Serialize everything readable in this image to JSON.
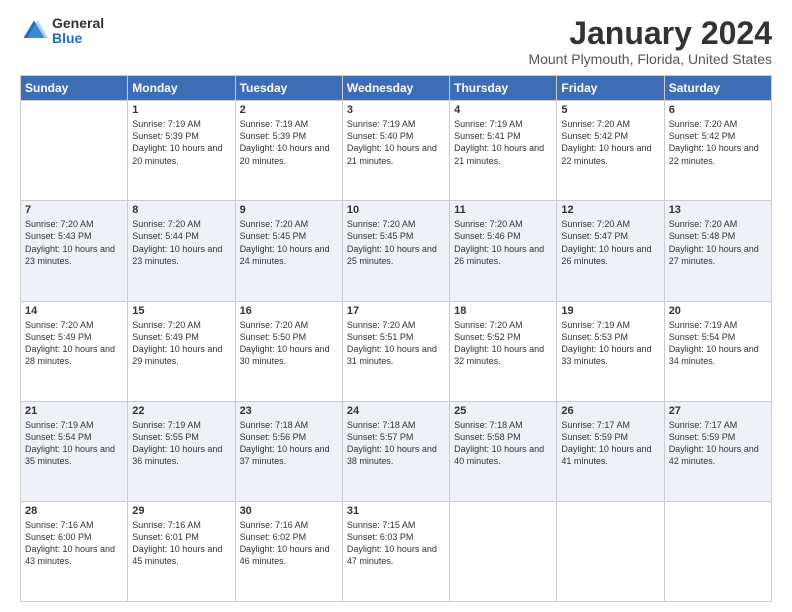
{
  "logo": {
    "general": "General",
    "blue": "Blue"
  },
  "header": {
    "title": "January 2024",
    "subtitle": "Mount Plymouth, Florida, United States"
  },
  "weekdays": [
    "Sunday",
    "Monday",
    "Tuesday",
    "Wednesday",
    "Thursday",
    "Friday",
    "Saturday"
  ],
  "weeks": [
    [
      {
        "day": "",
        "sunrise": "",
        "sunset": "",
        "daylight": ""
      },
      {
        "day": "1",
        "sunrise": "Sunrise: 7:19 AM",
        "sunset": "Sunset: 5:39 PM",
        "daylight": "Daylight: 10 hours and 20 minutes."
      },
      {
        "day": "2",
        "sunrise": "Sunrise: 7:19 AM",
        "sunset": "Sunset: 5:39 PM",
        "daylight": "Daylight: 10 hours and 20 minutes."
      },
      {
        "day": "3",
        "sunrise": "Sunrise: 7:19 AM",
        "sunset": "Sunset: 5:40 PM",
        "daylight": "Daylight: 10 hours and 21 minutes."
      },
      {
        "day": "4",
        "sunrise": "Sunrise: 7:19 AM",
        "sunset": "Sunset: 5:41 PM",
        "daylight": "Daylight: 10 hours and 21 minutes."
      },
      {
        "day": "5",
        "sunrise": "Sunrise: 7:20 AM",
        "sunset": "Sunset: 5:42 PM",
        "daylight": "Daylight: 10 hours and 22 minutes."
      },
      {
        "day": "6",
        "sunrise": "Sunrise: 7:20 AM",
        "sunset": "Sunset: 5:42 PM",
        "daylight": "Daylight: 10 hours and 22 minutes."
      }
    ],
    [
      {
        "day": "7",
        "sunrise": "Sunrise: 7:20 AM",
        "sunset": "Sunset: 5:43 PM",
        "daylight": "Daylight: 10 hours and 23 minutes."
      },
      {
        "day": "8",
        "sunrise": "Sunrise: 7:20 AM",
        "sunset": "Sunset: 5:44 PM",
        "daylight": "Daylight: 10 hours and 23 minutes."
      },
      {
        "day": "9",
        "sunrise": "Sunrise: 7:20 AM",
        "sunset": "Sunset: 5:45 PM",
        "daylight": "Daylight: 10 hours and 24 minutes."
      },
      {
        "day": "10",
        "sunrise": "Sunrise: 7:20 AM",
        "sunset": "Sunset: 5:45 PM",
        "daylight": "Daylight: 10 hours and 25 minutes."
      },
      {
        "day": "11",
        "sunrise": "Sunrise: 7:20 AM",
        "sunset": "Sunset: 5:46 PM",
        "daylight": "Daylight: 10 hours and 26 minutes."
      },
      {
        "day": "12",
        "sunrise": "Sunrise: 7:20 AM",
        "sunset": "Sunset: 5:47 PM",
        "daylight": "Daylight: 10 hours and 26 minutes."
      },
      {
        "day": "13",
        "sunrise": "Sunrise: 7:20 AM",
        "sunset": "Sunset: 5:48 PM",
        "daylight": "Daylight: 10 hours and 27 minutes."
      }
    ],
    [
      {
        "day": "14",
        "sunrise": "Sunrise: 7:20 AM",
        "sunset": "Sunset: 5:49 PM",
        "daylight": "Daylight: 10 hours and 28 minutes."
      },
      {
        "day": "15",
        "sunrise": "Sunrise: 7:20 AM",
        "sunset": "Sunset: 5:49 PM",
        "daylight": "Daylight: 10 hours and 29 minutes."
      },
      {
        "day": "16",
        "sunrise": "Sunrise: 7:20 AM",
        "sunset": "Sunset: 5:50 PM",
        "daylight": "Daylight: 10 hours and 30 minutes."
      },
      {
        "day": "17",
        "sunrise": "Sunrise: 7:20 AM",
        "sunset": "Sunset: 5:51 PM",
        "daylight": "Daylight: 10 hours and 31 minutes."
      },
      {
        "day": "18",
        "sunrise": "Sunrise: 7:20 AM",
        "sunset": "Sunset: 5:52 PM",
        "daylight": "Daylight: 10 hours and 32 minutes."
      },
      {
        "day": "19",
        "sunrise": "Sunrise: 7:19 AM",
        "sunset": "Sunset: 5:53 PM",
        "daylight": "Daylight: 10 hours and 33 minutes."
      },
      {
        "day": "20",
        "sunrise": "Sunrise: 7:19 AM",
        "sunset": "Sunset: 5:54 PM",
        "daylight": "Daylight: 10 hours and 34 minutes."
      }
    ],
    [
      {
        "day": "21",
        "sunrise": "Sunrise: 7:19 AM",
        "sunset": "Sunset: 5:54 PM",
        "daylight": "Daylight: 10 hours and 35 minutes."
      },
      {
        "day": "22",
        "sunrise": "Sunrise: 7:19 AM",
        "sunset": "Sunset: 5:55 PM",
        "daylight": "Daylight: 10 hours and 36 minutes."
      },
      {
        "day": "23",
        "sunrise": "Sunrise: 7:18 AM",
        "sunset": "Sunset: 5:56 PM",
        "daylight": "Daylight: 10 hours and 37 minutes."
      },
      {
        "day": "24",
        "sunrise": "Sunrise: 7:18 AM",
        "sunset": "Sunset: 5:57 PM",
        "daylight": "Daylight: 10 hours and 38 minutes."
      },
      {
        "day": "25",
        "sunrise": "Sunrise: 7:18 AM",
        "sunset": "Sunset: 5:58 PM",
        "daylight": "Daylight: 10 hours and 40 minutes."
      },
      {
        "day": "26",
        "sunrise": "Sunrise: 7:17 AM",
        "sunset": "Sunset: 5:59 PM",
        "daylight": "Daylight: 10 hours and 41 minutes."
      },
      {
        "day": "27",
        "sunrise": "Sunrise: 7:17 AM",
        "sunset": "Sunset: 5:59 PM",
        "daylight": "Daylight: 10 hours and 42 minutes."
      }
    ],
    [
      {
        "day": "28",
        "sunrise": "Sunrise: 7:16 AM",
        "sunset": "Sunset: 6:00 PM",
        "daylight": "Daylight: 10 hours and 43 minutes."
      },
      {
        "day": "29",
        "sunrise": "Sunrise: 7:16 AM",
        "sunset": "Sunset: 6:01 PM",
        "daylight": "Daylight: 10 hours and 45 minutes."
      },
      {
        "day": "30",
        "sunrise": "Sunrise: 7:16 AM",
        "sunset": "Sunset: 6:02 PM",
        "daylight": "Daylight: 10 hours and 46 minutes."
      },
      {
        "day": "31",
        "sunrise": "Sunrise: 7:15 AM",
        "sunset": "Sunset: 6:03 PM",
        "daylight": "Daylight: 10 hours and 47 minutes."
      },
      {
        "day": "",
        "sunrise": "",
        "sunset": "",
        "daylight": ""
      },
      {
        "day": "",
        "sunrise": "",
        "sunset": "",
        "daylight": ""
      },
      {
        "day": "",
        "sunrise": "",
        "sunset": "",
        "daylight": ""
      }
    ]
  ]
}
